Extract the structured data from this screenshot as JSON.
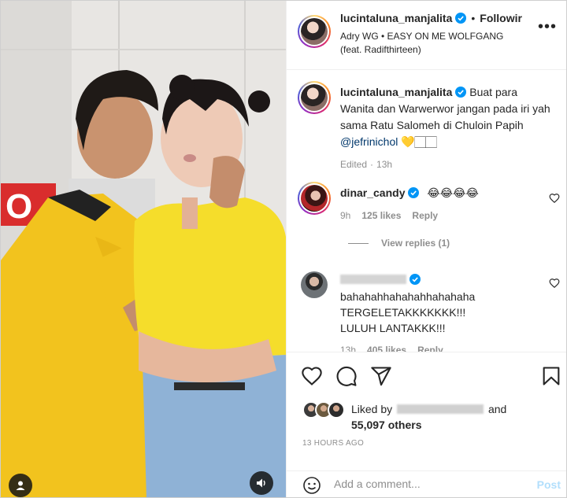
{
  "post": {
    "username": "lucintaluna_manjalita",
    "follow_label": "Followir",
    "audio": "Adry WG • EASY ON ME WOLFGANG (feat. Radifthirteen)",
    "more_label": "•••"
  },
  "caption": {
    "username": "lucintaluna_manjalita",
    "text": "Buat para Wanita dan Warwerwor jangan pada iri yah sama Ratu Salomeh di Chuloin Papih ",
    "mention": "@jefrinichol",
    "emoji": " 💛🏻🏻",
    "edited_label": "Edited",
    "time": "13h"
  },
  "comments": [
    {
      "username": "dinar_candy",
      "text": "😂😂😂😂",
      "time": "9h",
      "likes": "125 likes",
      "reply_label": "Reply",
      "view_replies": "View replies (1)"
    },
    {
      "username": "",
      "text": "bahahahhahahahhahahaha TERGELETAKKKKKKK!!! LULUH LANTAKKK!!!",
      "time": "13h",
      "likes": "405 likes",
      "reply_label": "Reply"
    }
  ],
  "engagement": {
    "liked_by_label": "Liked by",
    "and_label": "and",
    "others": "55,097 others",
    "time_ago": "13 HOURS AGO"
  },
  "composer": {
    "placeholder": "Add a comment...",
    "post_label": "Post"
  },
  "colors": {
    "link": "#00376b",
    "verified": "#0095f6",
    "muted": "#8e8e8e",
    "post_disabled": "#b2dffc",
    "shirt": "#f2c31e"
  }
}
